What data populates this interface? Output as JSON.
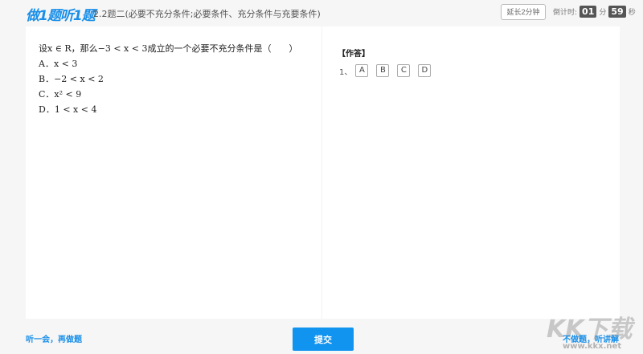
{
  "header": {
    "logo": "做1题听1题",
    "title": "2.2题二(必要不充分条件;必要条件、充分条件与充要条件)",
    "extend_button": "延长2分钟",
    "countdown_label": "倒计时:",
    "minutes": "01",
    "min_unit": "分",
    "seconds": "59",
    "sec_unit": "秒"
  },
  "question": {
    "stem": "设x ∈ R，那么−3 < x < 3成立的一个必要不充分条件是（　　）",
    "options": [
      "A．x < 3",
      "B．−2 < x < 2",
      "C．x² < 9",
      "D．1 < x < 4"
    ]
  },
  "answer": {
    "heading": "【作答】",
    "number": "1、",
    "choices": [
      "A",
      "B",
      "C",
      "D"
    ]
  },
  "footer": {
    "later": "听一会，再做题",
    "submit": "提交",
    "skip": "不做题，听讲解"
  },
  "watermark": {
    "brand": "KK下载",
    "url": "www.kkx.net"
  }
}
